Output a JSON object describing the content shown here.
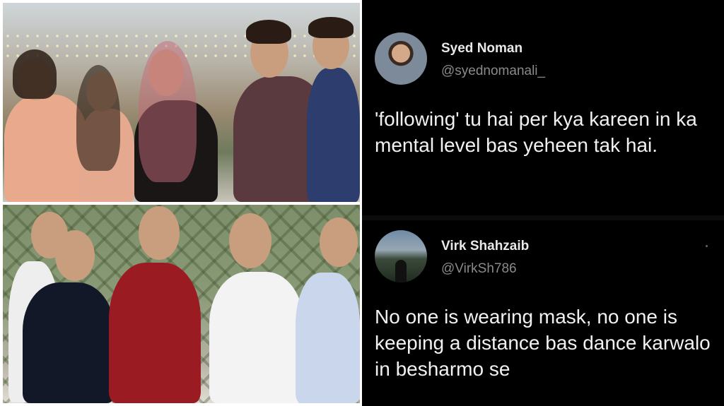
{
  "tweets": [
    {
      "name": "Syed Noman",
      "handle": "@syednomanali_",
      "text": "'following' tu hai per kya kareen in ka mental level bas yeheen tak hai."
    },
    {
      "name": "Virk Shahzaib",
      "handle": "@VirkSh786",
      "text": "No one is wearing mask, no one is keeping a distance bas dance karwalo in besharmo se"
    }
  ],
  "colors": {
    "tweet_bg": "#000000",
    "name": "#e9e9e9",
    "handle": "#8a8a8a",
    "text": "#f1f1f1"
  }
}
